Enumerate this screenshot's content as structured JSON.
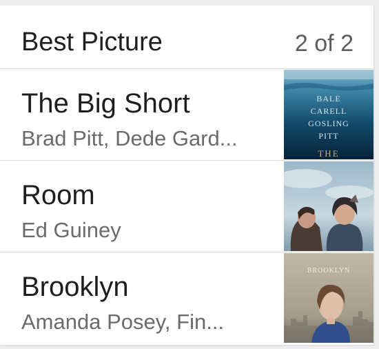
{
  "header": {
    "title": "Best Picture",
    "page_indicator": "2 of 2"
  },
  "items": [
    {
      "title": "The Big Short",
      "subtitle": "Brad Pitt, Dede Gard...",
      "poster_text": [
        "BALE",
        "CARELL",
        "GOSLING",
        "PITT",
        "THE"
      ]
    },
    {
      "title": "Room",
      "subtitle": "Ed Guiney"
    },
    {
      "title": "Brooklyn",
      "subtitle": "Amanda Posey, Fin...",
      "poster_text": [
        "BROOKLYN"
      ]
    }
  ],
  "colors": {
    "primary_text": "#1e1e1e",
    "secondary_text": "#6b6b6b",
    "divider": "#dcdcdc"
  }
}
